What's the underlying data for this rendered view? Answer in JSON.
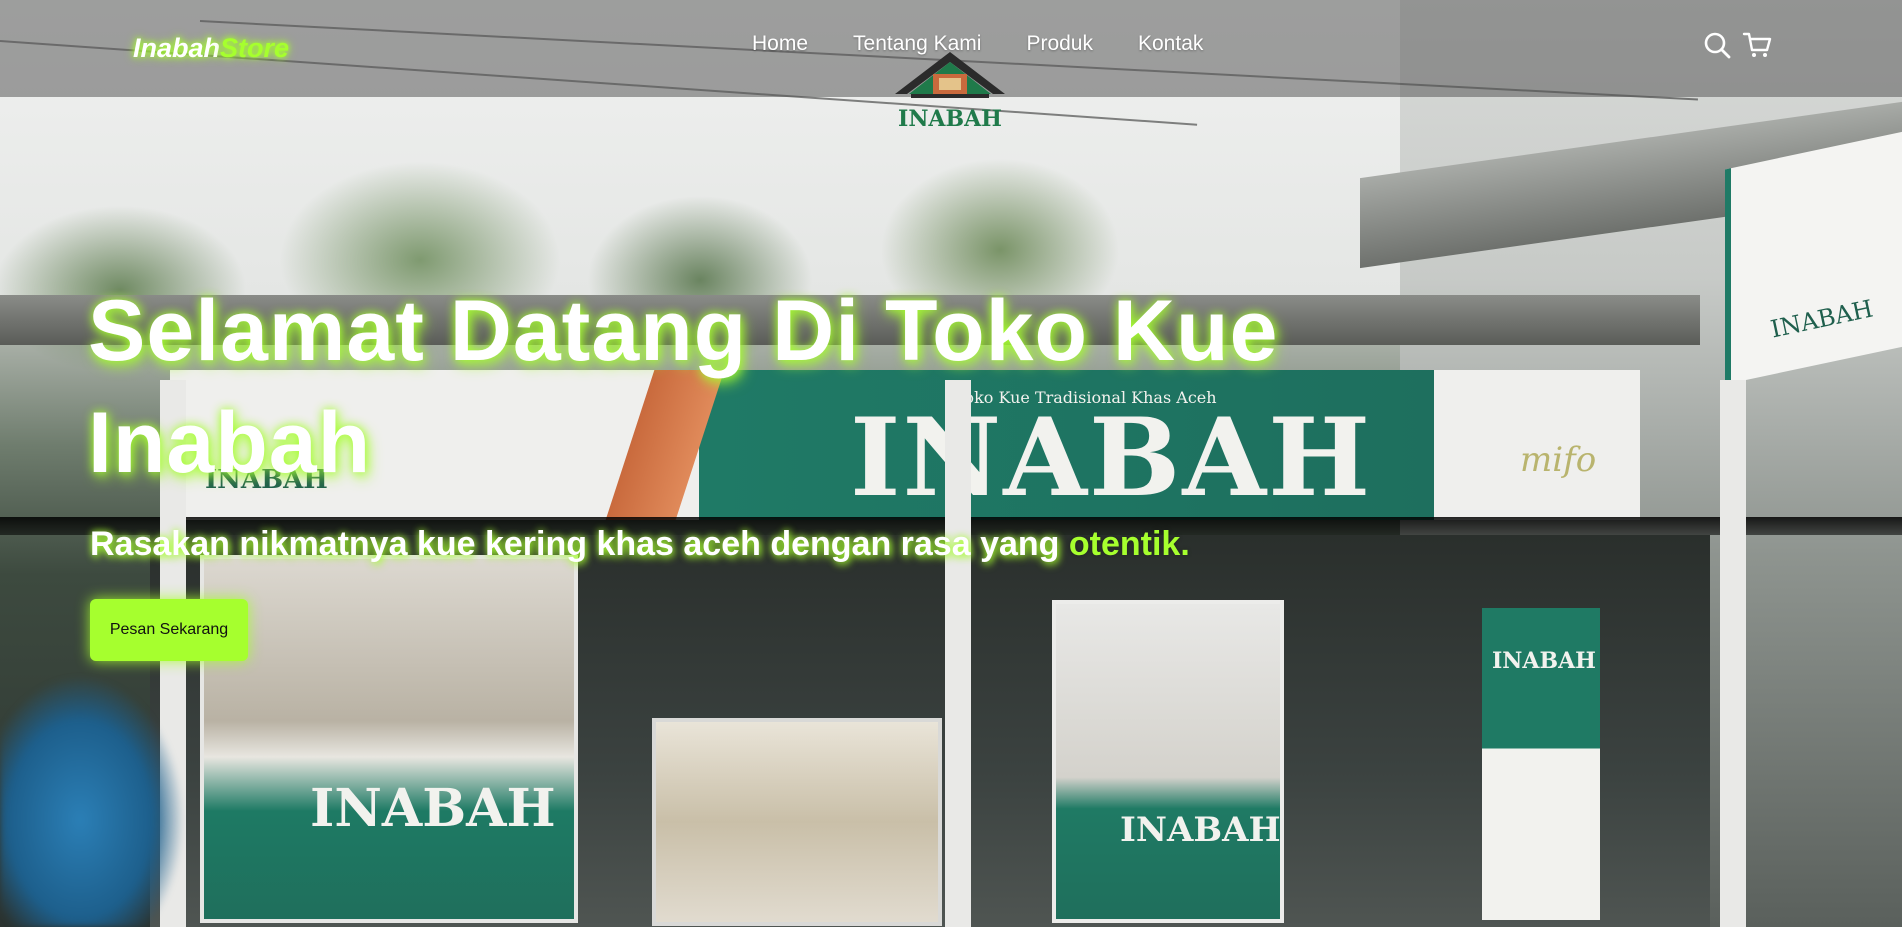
{
  "nav": {
    "brand_main": "Inabah",
    "brand_accent": "Store",
    "links": [
      "Home",
      "Tentang Kami",
      "Produk",
      "Kontak"
    ],
    "icons": [
      "search-icon",
      "cart-icon"
    ]
  },
  "logo": {
    "text": "INABAH"
  },
  "hero": {
    "title": "Selamat Datang Di Toko Kue Inabah",
    "subtitle_main": "Rasakan nikmatnya kue kering khas aceh dengan rasa yang ",
    "subtitle_highlight": "otentik.",
    "cta_label": "Pesan Sekarang"
  },
  "photo": {
    "sign_main": "INABAH",
    "sign_tagline": "Toko Kue Tradisional Khas Aceh",
    "sign_right": "mifo",
    "cabinet_left": "INABAH",
    "cabinet_right": "INABAH",
    "rollup": "INABAH"
  },
  "colors": {
    "accent": "#a6ff2e",
    "brand_green": "#1f7a64"
  }
}
